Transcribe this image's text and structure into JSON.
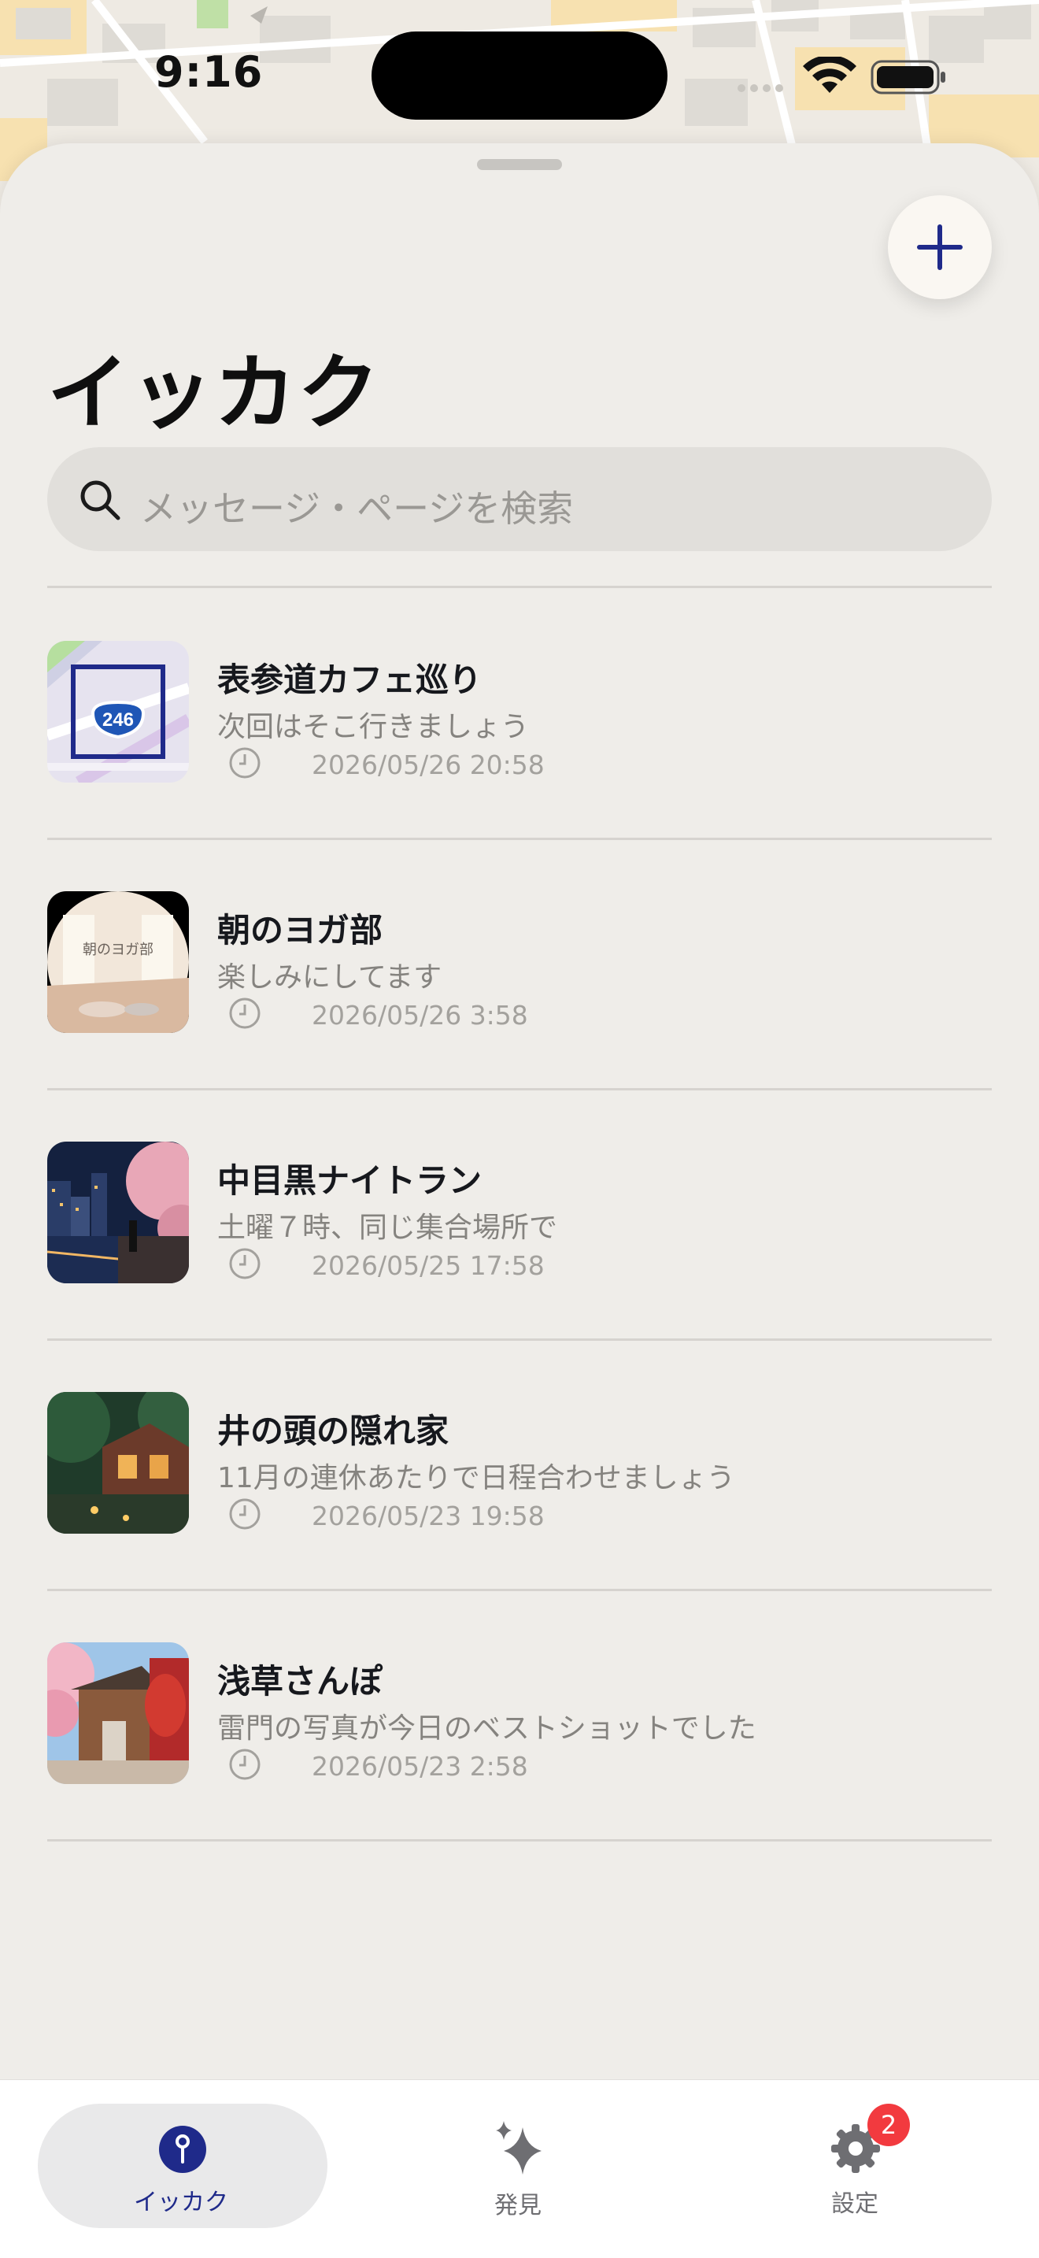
{
  "status_bar": {
    "time": "9:16"
  },
  "header": {
    "title": "イッカク",
    "add_button_icon": "plus-icon",
    "accent_color": "#1f2a8a"
  },
  "search": {
    "placeholder": "メッセージ・ページを検索",
    "icon": "search-icon"
  },
  "chats": [
    {
      "title": "表参道カフェ巡り",
      "message": "次回はそこ行きましょう",
      "time": "2026/05/26 20:58",
      "thumb_label": "246",
      "thumb_type": "map"
    },
    {
      "title": "朝のヨガ部",
      "message": "楽しみにしてます",
      "time": "2026/05/26 3:58",
      "thumb_label": "朝のヨガ部",
      "thumb_type": "yoga"
    },
    {
      "title": "中目黒ナイトラン",
      "message": "土曜７時、同じ集合場所で",
      "time": "2026/05/25 17:58",
      "thumb_type": "night-run"
    },
    {
      "title": "井の頭の隠れ家",
      "message": "11月の連休あたりで日程合わせましょう",
      "time": "2026/05/23 19:58",
      "thumb_type": "house"
    },
    {
      "title": "浅草さんぽ",
      "message": "雷門の写真が今日のベストショットでした",
      "time": "2026/05/23 2:58",
      "thumb_type": "asakusa"
    }
  ],
  "tab_bar": {
    "tabs": [
      {
        "label": "イッカク",
        "icon": "pin-icon",
        "active": true
      },
      {
        "label": "発見",
        "icon": "sparkles-icon",
        "active": false
      },
      {
        "label": "設定",
        "icon": "gear-icon",
        "active": false,
        "badge": "2"
      }
    ]
  }
}
